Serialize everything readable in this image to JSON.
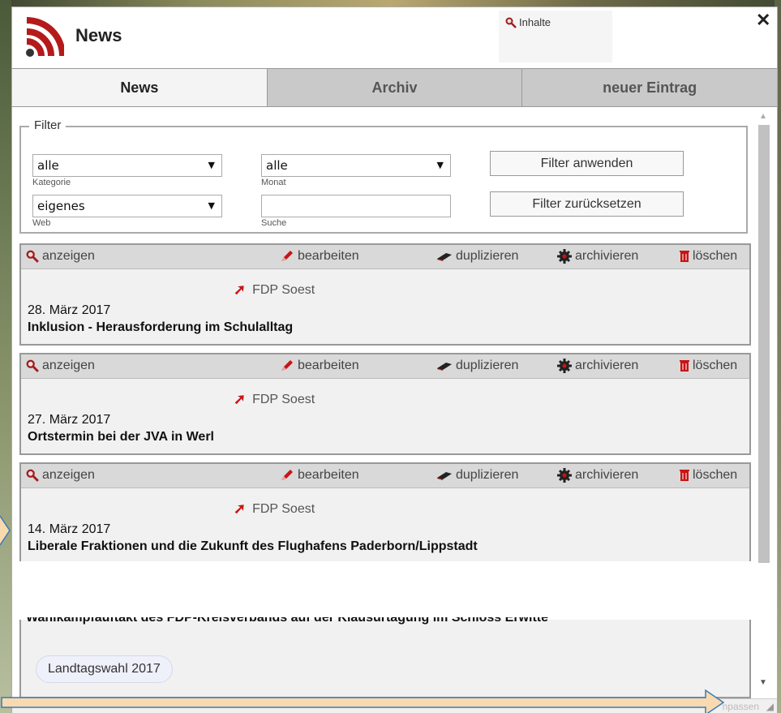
{
  "window": {
    "title": "News",
    "close_symbol": "✕"
  },
  "inhalte_link": "Inhalte",
  "tabs": [
    {
      "label": "News",
      "active": true
    },
    {
      "label": "Archiv",
      "active": false
    },
    {
      "label": "neuer Eintrag",
      "active": false
    }
  ],
  "filter": {
    "legend": "Filter",
    "kategorie": {
      "value": "alle",
      "caption": "Kategorie"
    },
    "monat": {
      "value": "alle",
      "caption": "Monat"
    },
    "web": {
      "value": "eigenes",
      "caption": "Web"
    },
    "suche": {
      "value": "",
      "caption": "Suche"
    },
    "apply_label": "Filter anwenden",
    "reset_label": "Filter zurücksetzen"
  },
  "actions": {
    "show": "anzeigen",
    "edit": "bearbeiten",
    "duplicate": "duplizieren",
    "archive": "archivieren",
    "delete": "löschen"
  },
  "news_items": [
    {
      "source": "FDP Soest",
      "date": "28. März 2017",
      "title": "Inklusion - Herausforderung im Schulalltag"
    },
    {
      "source": "FDP Soest",
      "date": "27. März 2017",
      "title": "Ortstermin bei der JVA in Werl"
    },
    {
      "source": "FDP Soest",
      "date": "14. März 2017",
      "title": "Liberale Fraktionen und die Zukunft des Flughafens Paderborn/Lippstadt"
    }
  ],
  "partial_item": {
    "title_fragment": "Wahlkampfauftakt des FDP-Kreisverbands auf der Klausurtagung im Schloss Erwitte",
    "tag": "Landtagswahl 2017"
  },
  "footer": {
    "hint": "npassen"
  },
  "colors": {
    "accent_red": "#c81414",
    "rss_red": "#b51a1a",
    "callout_arrow": "#f9d9b0"
  }
}
